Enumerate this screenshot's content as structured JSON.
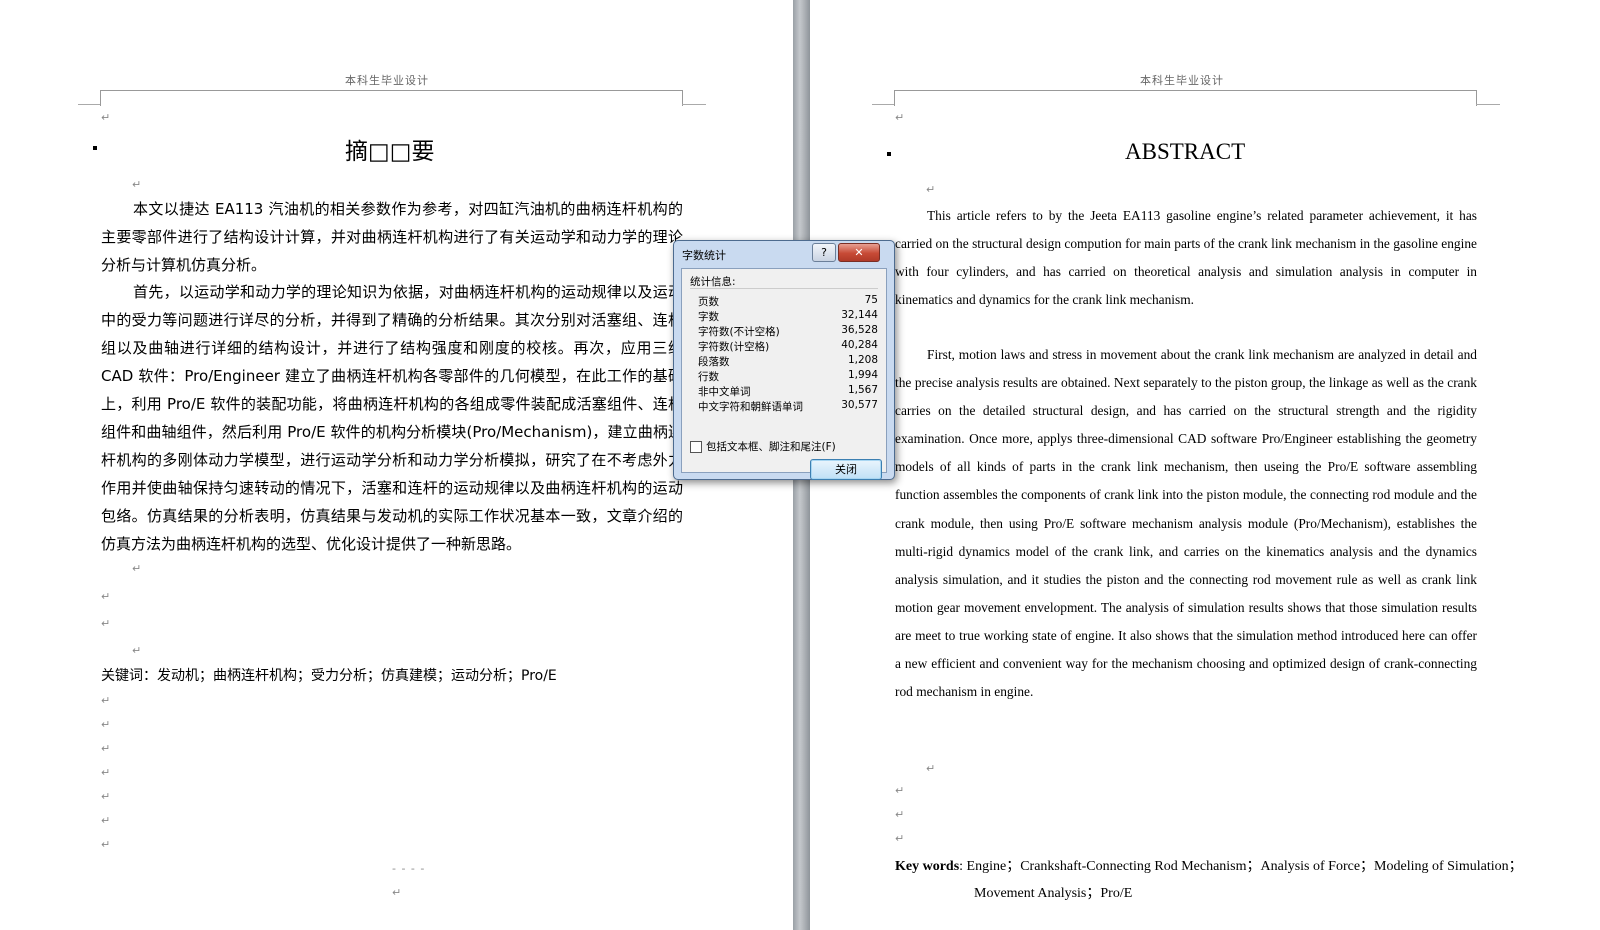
{
  "page_header": "本科生毕业设计",
  "paragraph_mark": "↵",
  "left_page": {
    "title": "摘□□要",
    "paragraphs": [
      "本文以捷达 EA113 汽油机的相关参数作为参考，对四缸汽油机的曲柄连杆机构的主要零部件进行了结构设计计算，并对曲柄连杆机构进行了有关运动学和动力学的理论分析与计算机仿真分析。",
      "首先，以运动学和动力学的理论知识为依据，对曲柄连杆机构的运动规律以及运动中的受力等问题进行详尽的分析，并得到了精确的分析结果。其次分别对活塞组、连杆组以及曲轴进行详细的结构设计，并进行了结构强度和刚度的校核。再次，应用三维 CAD 软件：Pro/Engineer 建立了曲柄连杆机构各零部件的几何模型，在此工作的基础上，利用 Pro/E 软件的装配功能，将曲柄连杆机构的各组成零件装配成活塞组件、连杆组件和曲轴组件，然后利用 Pro/E 软件的机构分析模块(Pro/Mechanism)，建立曲柄连杆机构的多刚体动力学模型，进行运动学分析和动力学分析模拟，研究了在不考虑外力作用并使曲轴保持匀速转动的情况下，活塞和连杆的运动规律以及曲柄连杆机构的运动包络。仿真结果的分析表明，仿真结果与发动机的实际工作状况基本一致，文章介绍的仿真方法为曲柄连杆机构的选型、优化设计提供了一种新思路。"
    ],
    "keywords": "关键词：发动机；曲柄连杆机构；受力分析；仿真建模；运动分析；Pro/E",
    "footer_marks": "- - - -"
  },
  "right_page": {
    "title": "ABSTRACT",
    "paragraphs": [
      "This article refers to by the Jeeta EA113 gasoline engine’s related parameter achievement, it has carried on the structural design compution for main parts of the crank link mechanism in the gasoline engine with four cylinders, and has carried on theoretical analysis and simulation analysis in computer in kinematics and dynamics for the crank link mechanism.",
      "First, motion laws and stress in movement about the crank link mechanism are analyzed in detail and the precise analysis results are obtained. Next separately to the piston group, the linkage as well as the crank carries on the detailed structural design, and has carried on the structural strength and the rigidity examination. Once more, applys three-dimensional CAD software Pro/Engineer establishing the geometry models of all kinds of parts in the crank link mechanism, then useing the Pro/E software assembling function assembles the components of crank link into the piston module, the connecting rod module and the crank module, then using Pro/E software mechanism analysis module (Pro/Mechanism), establishes the multi-rigid dynamics model of the crank link, and carries on the kinematics analysis and the dynamics analysis simulation, and it studies the piston and the connecting rod movement rule as well as crank link motion gear movement envelopment. The analysis of simulation results shows that those simulation results are meet to true working state of engine. It also shows that the simulation method introduced here can offer a new efficient and convenient way for the mechanism choosing and optimized design of crank-connecting rod mechanism in engine."
    ],
    "keywords_label": "Key words",
    "keywords_text": ": Engine；Crankshaft-Connecting Rod Mechanism；Analysis of Force；Modeling of Simulation；Movement Analysis；Pro/E"
  },
  "dialog": {
    "title": "字数统计",
    "help_label": "?",
    "close_label": "✕",
    "section_label": "统计信息:",
    "stats": [
      {
        "label": "页数",
        "value": "75"
      },
      {
        "label": "字数",
        "value": "32,144"
      },
      {
        "label": "字符数(不计空格)",
        "value": "36,528"
      },
      {
        "label": "字符数(计空格)",
        "value": "40,284"
      },
      {
        "label": "段落数",
        "value": "1,208"
      },
      {
        "label": "行数",
        "value": "1,994"
      },
      {
        "label": "非中文单词",
        "value": "1,567"
      },
      {
        "label": "中文字符和朝鲜语单词",
        "value": "30,577"
      }
    ],
    "checkbox_label": "包括文本框、脚注和尾注(F)",
    "checkbox_checked": false,
    "close_button": "关闭"
  }
}
